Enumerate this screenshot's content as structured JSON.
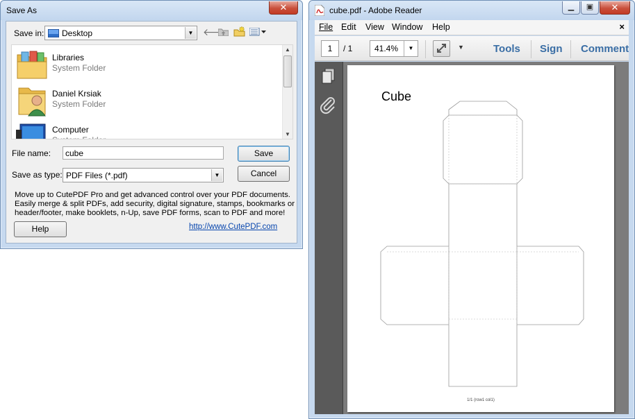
{
  "save_dialog": {
    "title": "Save As",
    "close_glyph": "✕",
    "save_in_label": "Save in:",
    "save_in_value": "Desktop",
    "files": [
      {
        "name": "Libraries",
        "type": "System Folder",
        "icon": "libraries-folder-icon"
      },
      {
        "name": "Daniel Krsiak",
        "type": "System Folder",
        "icon": "user-folder-icon"
      },
      {
        "name": "Computer",
        "type": "System Folder",
        "icon": "computer-icon"
      }
    ],
    "file_name_label": "File name:",
    "file_name_value": "cube",
    "save_as_type_label": "Save as type:",
    "save_as_type_value": "PDF Files (*.pdf)",
    "save_button": "Save",
    "cancel_button": "Cancel",
    "help_button": "Help",
    "promo_lines": [
      "Move up to CutePDF Pro and get advanced control over your PDF documents.",
      "Easily merge & split PDFs, add security, digital signature, stamps, bookmarks or",
      "header/footer, make booklets, n-Up, save PDF forms, scan to PDF and more!"
    ],
    "link": "http://www.CutePDF.com"
  },
  "reader": {
    "title": "cube.pdf - Adobe Reader",
    "menu": [
      "File",
      "Edit",
      "View",
      "Window",
      "Help"
    ],
    "menu_close": "×",
    "page_current": "1",
    "page_total": "/ 1",
    "zoom": "41.4%",
    "tools": [
      "Tools",
      "Sign",
      "Comment"
    ],
    "document": {
      "title": "Cube",
      "footer": "1/1 (row1 col1)"
    }
  },
  "colors": {
    "link": "#0645ad",
    "reader_accent": "#3a6ea5",
    "close_button": "#c9503c"
  }
}
